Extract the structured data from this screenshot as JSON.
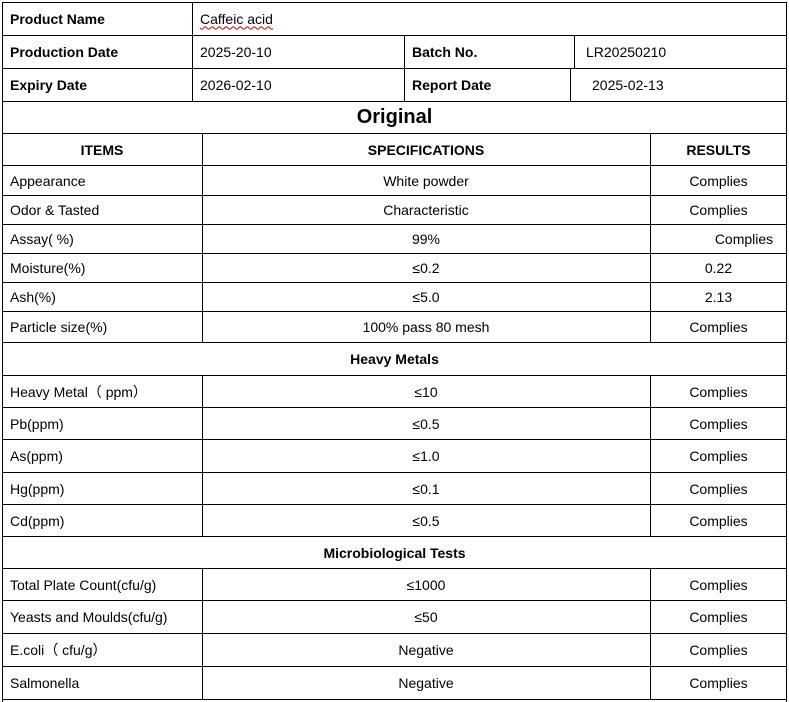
{
  "header": {
    "product_name_label": "Product Name",
    "product_name_value": "Caffeic acid",
    "production_date_label": "Production Date",
    "production_date_value": "2025-20-10",
    "batch_no_label": "Batch No.",
    "batch_no_value": "LR20250210",
    "expiry_date_label": "Expiry Date",
    "expiry_date_value": "2026-02-10",
    "report_date_label": "Report Date",
    "report_date_value": "2025-02-13"
  },
  "title": "Original",
  "columns": {
    "items": "ITEMS",
    "specifications": "SPECIFICATIONS",
    "results": "RESULTS"
  },
  "general_tests": [
    {
      "item": "Appearance",
      "spec": "White powder",
      "result": "Complies"
    },
    {
      "item": "Odor & Tasted",
      "spec": "Characteristic",
      "result": "Complies"
    },
    {
      "item": "Assay( %)",
      "spec": "99%",
      "result": "Complies"
    },
    {
      "item": "Moisture(%)",
      "spec": "≤0.2",
      "result": "0.22"
    },
    {
      "item": "Ash(%)",
      "spec": "≤5.0",
      "result": "2.13"
    },
    {
      "item": "Particle size(%)",
      "spec": "100% pass 80 mesh",
      "result": "Complies"
    }
  ],
  "heavy_metals_title": "Heavy Metals",
  "heavy_metals": [
    {
      "item": "Heavy Metal（ ppm）",
      "spec": "≤10",
      "result": "Complies"
    },
    {
      "item": "Pb(ppm)",
      "spec": "≤0.5",
      "result": "Complies"
    },
    {
      "item": "As(ppm)",
      "spec": "≤1.0",
      "result": "Complies"
    },
    {
      "item": "Hg(ppm)",
      "spec": "≤0.1",
      "result": "Complies"
    },
    {
      "item": "Cd(ppm)",
      "spec": "≤0.5",
      "result": "Complies"
    }
  ],
  "micro_title": "Microbiological Tests",
  "micro_tests": [
    {
      "item": "Total Plate Count(cfu/g)",
      "spec": "≤1000",
      "result": "Complies"
    },
    {
      "item": "Yeasts and Moulds(cfu/g)",
      "spec": "≤50",
      "result": "Complies"
    },
    {
      "item": "E.coli（ cfu/g）",
      "spec": "Negative",
      "result": "Complies"
    },
    {
      "item": "Salmonella",
      "spec": "Negative",
      "result": "Complies"
    }
  ]
}
